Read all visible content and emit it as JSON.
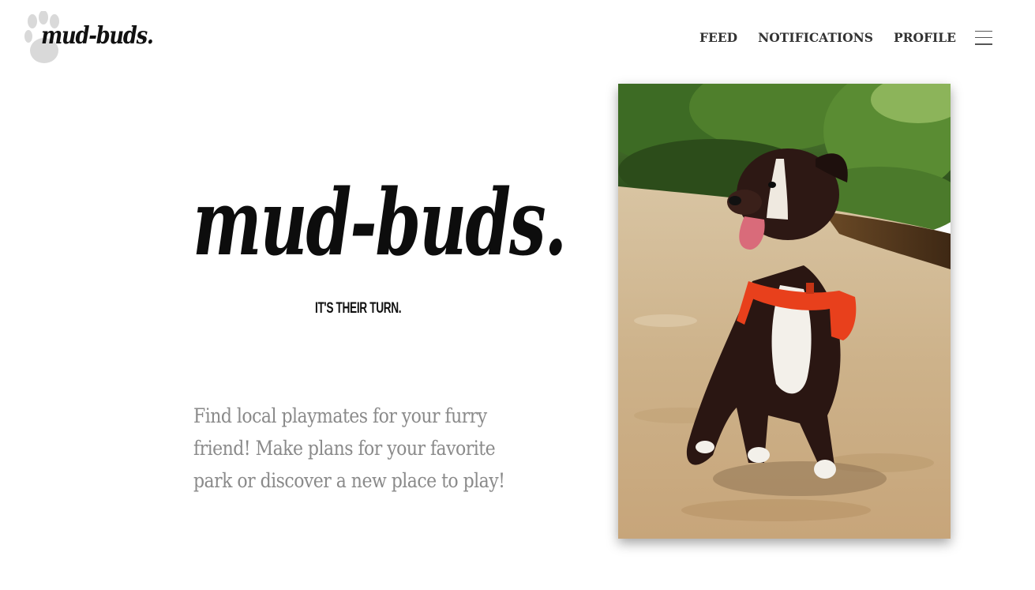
{
  "brand": {
    "logo_text": "mud-buds.",
    "logo_icon": "paw-print-icon"
  },
  "nav": {
    "items": [
      {
        "label": "FEED",
        "icon": null
      },
      {
        "label": "NOTIFICATIONS",
        "icon": null
      },
      {
        "label": "PROFILE",
        "icon": null
      }
    ],
    "menu_icon": "hamburger-menu-icon"
  },
  "hero": {
    "title": "mud-buds.",
    "tagline": "IT'S THEIR TURN.",
    "description": "Find local playmates for your furry friend! Make plans for your favorite park or discover a new place to play!",
    "photo_subject": "dog-photo"
  },
  "colors": {
    "text_dark": "#0d0d0d",
    "nav_text": "#333333",
    "description_text": "#8a8a8a",
    "paw_gray": "#d6d6d6",
    "vest_orange": "#e8401c",
    "background": "#ffffff"
  }
}
